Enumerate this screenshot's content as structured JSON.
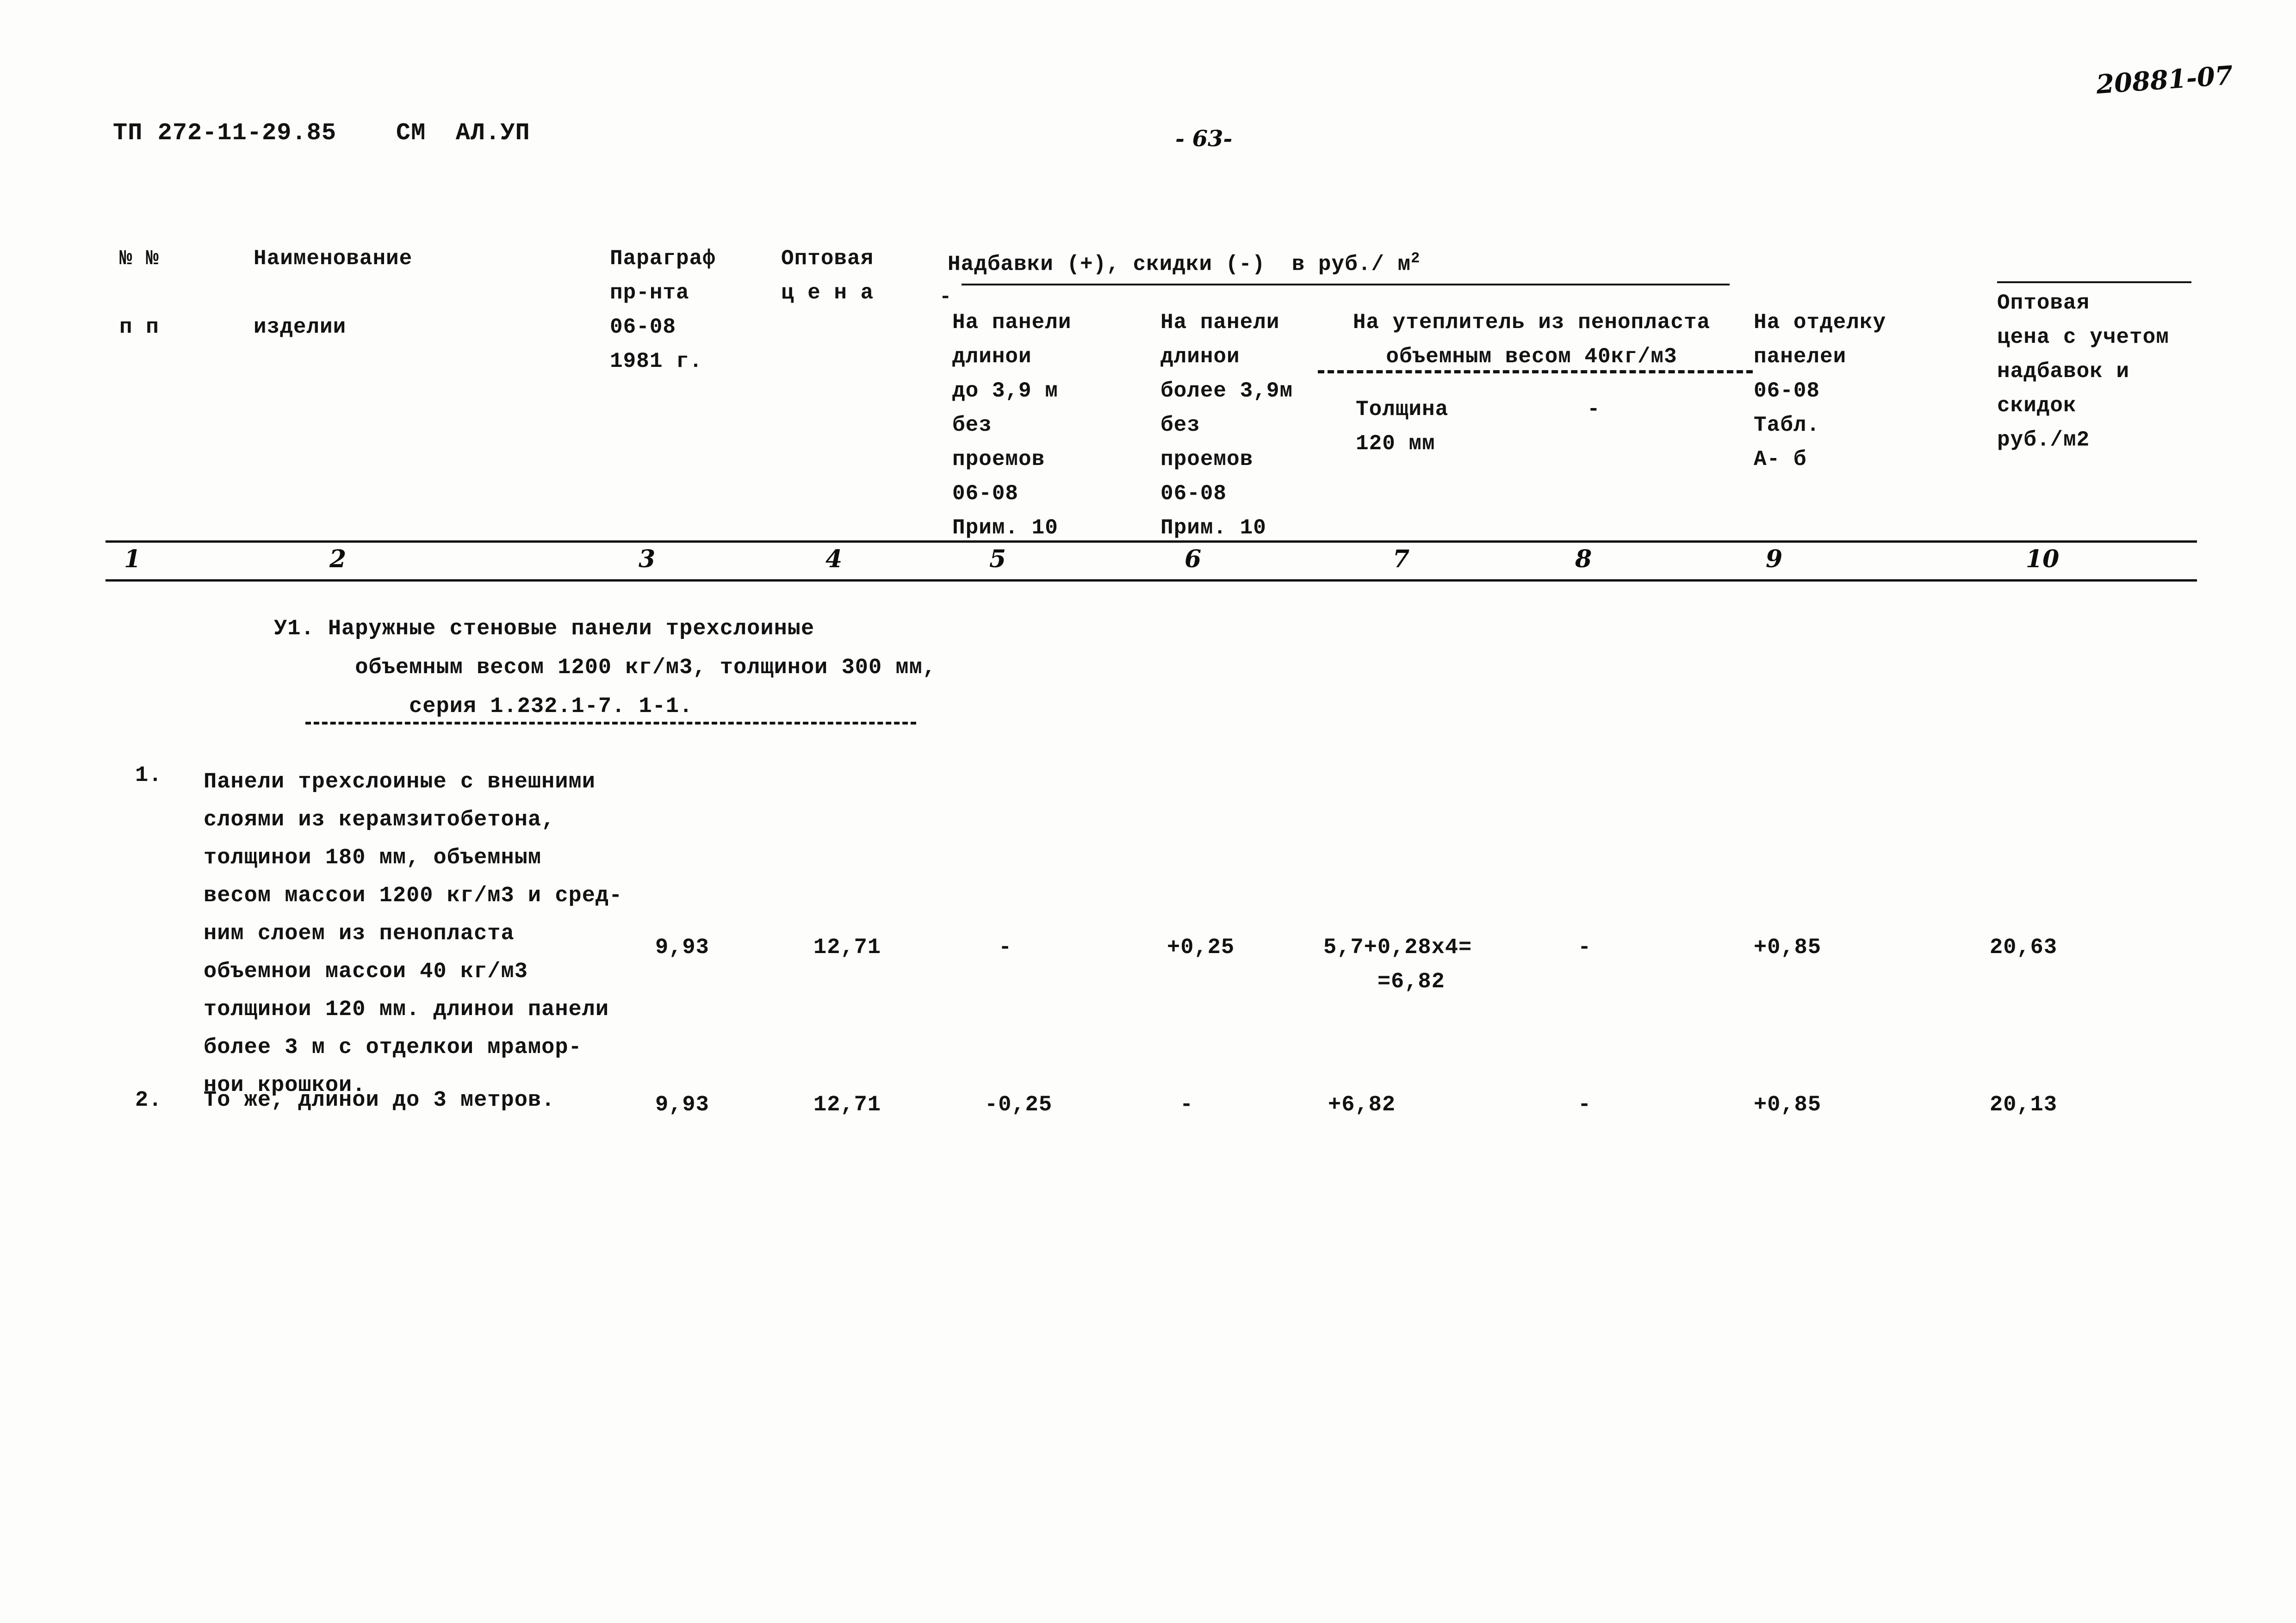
{
  "document": {
    "code": "ТП 272-11-29.85    СМ  АЛ.УП",
    "page_number": "- 63-",
    "archive_code": "20881-07"
  },
  "table": {
    "headers": {
      "col1": "№ №\n\nп п",
      "col2": "Наименование\n\nизделии",
      "col3": "Параграф\nпр-нта\n06-08\n1981 г.",
      "col4": "Оптовая\nц е н а",
      "group_surcharges": "Надбавки (+), скидки (-)  в руб./ м",
      "group_surcharges_sup": "2",
      "group_dash": "-",
      "col5": "На панели\nдлинои\nдо 3,9 м\nбез\nпроемов\n06-08\nПрим. 10",
      "col6": "На панели\nдлинои\nболее 3,9м\nбез\nпроемов\n06-08\nПрим. 10",
      "group_insulation": "На утеплитель из пенопласта\nобъемным весом 40кг/м3",
      "col7": "Толщина\n120 мм",
      "col8": "-",
      "col9": "На отделку\nпанелеи\n06-08\nТабл.\nА- б",
      "col10": "Оптовая\nцена с учетом\nнадбавок и\nскидок\nруб./м2"
    },
    "column_numbers": [
      "1",
      "2",
      "3",
      "4",
      "5",
      "6",
      "7",
      "8",
      "9",
      "10"
    ],
    "section_title": "У1. Наружные стеновые панели трехслоиные\n      объемным весом 1200 кг/м3, толщинои 300 мм,\n          серия 1.232.1-7. 1-1.",
    "rows": [
      {
        "index": "1.",
        "description": "Панели трехслоиные с внешними\nслоями из керамзитобетона,\nтолщинои 180 мм, объемным\nвесом массои 1200 кг/м3 и сред-\nним слоем из пенопласта\nобъемнои массои 40 кг/м3\nтолщинои 120 мм. длинои панели\nболее 3 м с отделкои мрамор-\nнои крошкои.",
        "col3": "9,93",
        "col4": "12,71",
        "col5": "-",
        "col6": "+0,25",
        "col7": "5,7+0,28х4=\n    =6,82",
        "col8": "-",
        "col9": "+0,85",
        "col10": "20,63"
      },
      {
        "index": "2.",
        "description": "То же, длинои до 3 метров.",
        "col3": "9,93",
        "col4": "12,71",
        "col5": "-0,25",
        "col6": "-",
        "col7": "+6,82",
        "col8": "-",
        "col9": "+0,85",
        "col10": "20,13"
      }
    ]
  }
}
